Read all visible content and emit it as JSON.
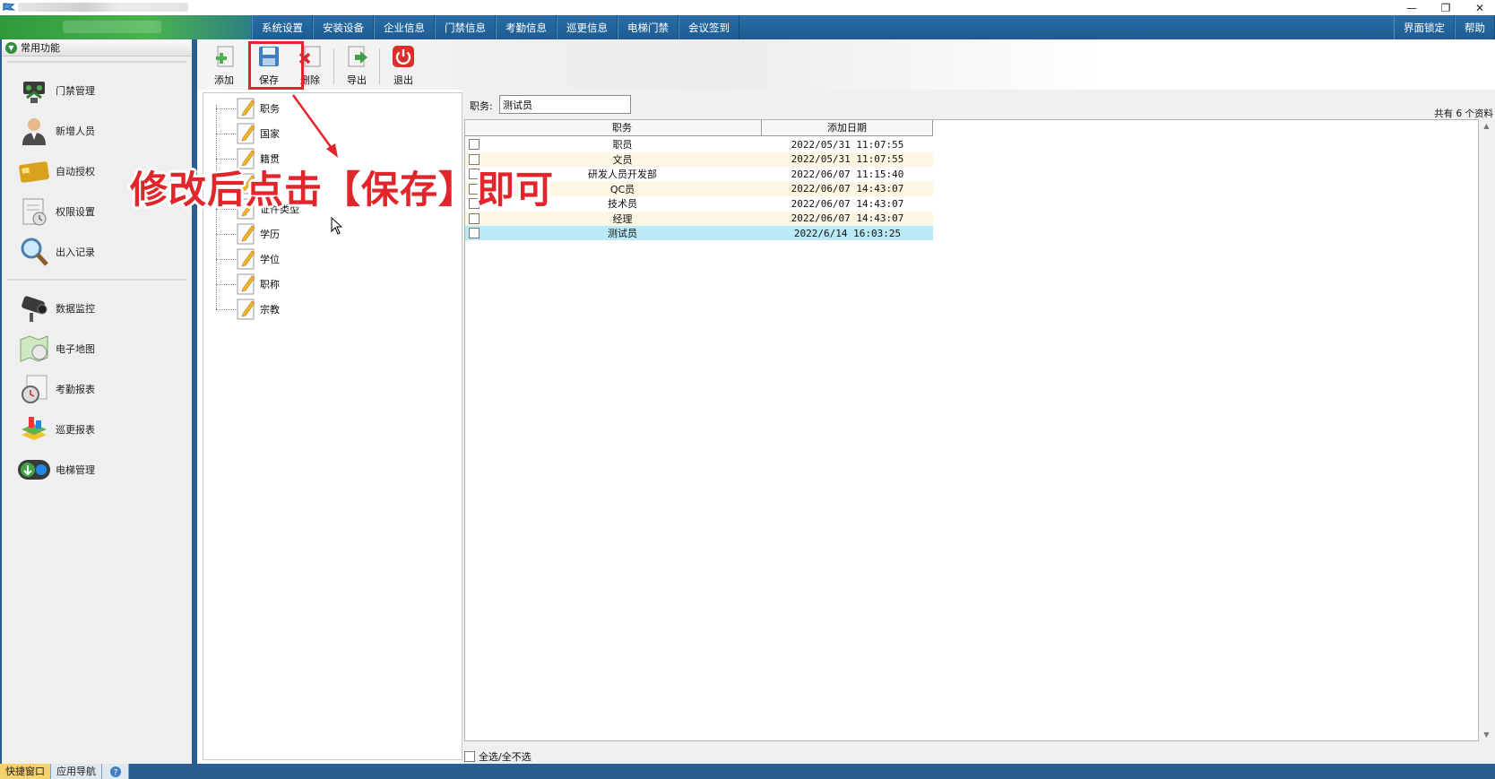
{
  "menu": {
    "items": [
      "系统设置",
      "安装设备",
      "企业信息",
      "门禁信息",
      "考勤信息",
      "巡更信息",
      "电梯门禁",
      "会议签到"
    ],
    "right": [
      "界面锁定",
      "帮助"
    ]
  },
  "window": {
    "minimize": "—",
    "restore": "❐",
    "close": "✕"
  },
  "sidebar": {
    "header": "常用功能",
    "group1": [
      {
        "label": "门禁管理",
        "icon": "door-access-icon"
      },
      {
        "label": "新增人员",
        "icon": "add-person-icon"
      },
      {
        "label": "自动授权",
        "icon": "card-icon"
      },
      {
        "label": "权限设置",
        "icon": "permission-icon"
      },
      {
        "label": "出入记录",
        "icon": "magnifier-icon"
      }
    ],
    "group2": [
      {
        "label": "数据监控",
        "icon": "camera-icon"
      },
      {
        "label": "电子地图",
        "icon": "map-icon"
      },
      {
        "label": "考勤报表",
        "icon": "clock-report-icon"
      },
      {
        "label": "巡更报表",
        "icon": "patrol-report-icon"
      },
      {
        "label": "电梯管理",
        "icon": "elevator-icon"
      }
    ],
    "bottom_tabs": [
      "快捷窗口",
      "应用导航"
    ]
  },
  "toolbar": {
    "add": "添加",
    "save": "保存",
    "delete": "删除",
    "export": "导出",
    "exit": "退出"
  },
  "tree": {
    "items": [
      "职务",
      "国家",
      "籍贯",
      "民族",
      "证件类型",
      "学历",
      "学位",
      "职称",
      "宗教"
    ]
  },
  "filter": {
    "label": "职务:",
    "value": "测试员"
  },
  "count_text": "共有 6 个资料",
  "grid": {
    "columns": [
      "职务",
      "添加日期"
    ],
    "rows": [
      {
        "name": "职员",
        "date": "2022/05/31 11:07:55"
      },
      {
        "name": "文员",
        "date": "2022/05/31 11:07:55"
      },
      {
        "name": "研发人员开发部",
        "date": "2022/06/07 11:15:40"
      },
      {
        "name": "QC员",
        "date": "2022/06/07 14:43:07"
      },
      {
        "name": "技术员",
        "date": "2022/06/07 14:43:07"
      },
      {
        "name": "经理",
        "date": "2022/06/07 14:43:07"
      },
      {
        "name": "测试员",
        "date": "2022/6/14 16:03:25"
      }
    ],
    "select_all": "全选/全不选"
  },
  "annotation": {
    "text": "修改后点击【保存】即可",
    "color": "#e0262b"
  },
  "colors": {
    "menubar": "#1b5c93",
    "row_alt": "#fdf6e3",
    "row_selected": "#b9eaf5"
  }
}
